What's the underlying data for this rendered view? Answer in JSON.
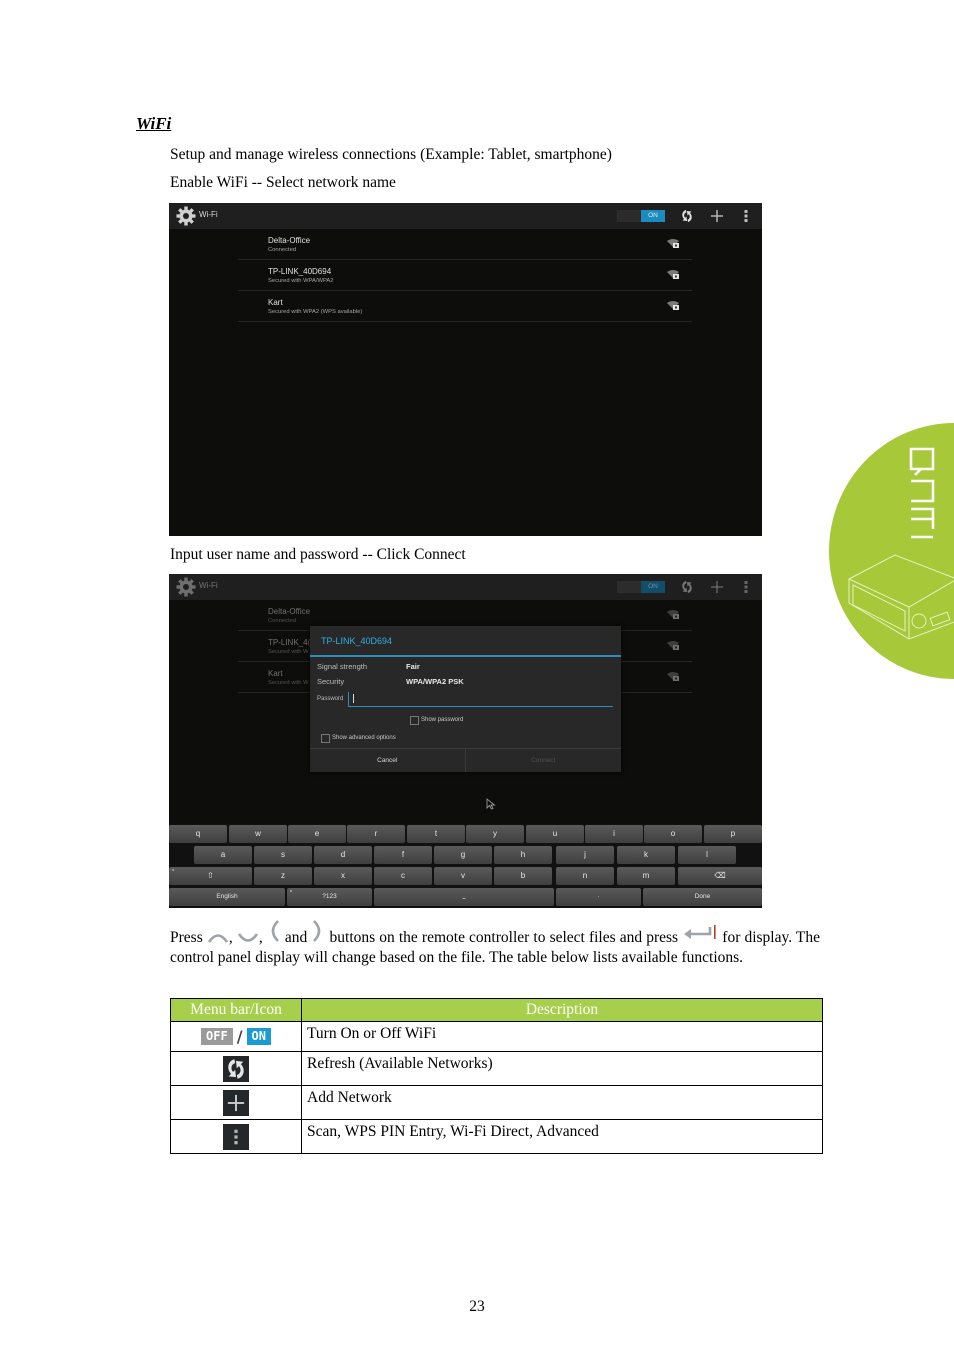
{
  "section_title": "WiFi",
  "intro_line1": "Setup and manage wireless connections (Example: Tablet, smartphone)",
  "intro_line2": "Enable WiFi -- Select network name",
  "caption2": "Input user name and password -- Click Connect",
  "wifi_screen": {
    "title": "Wi-Fi",
    "toggle_state": "ON",
    "icons": [
      "gear-icon",
      "refresh-icon",
      "add-icon",
      "overflow-menu-icon"
    ],
    "networks": [
      {
        "name": "Delta-Office",
        "status": "Connected"
      },
      {
        "name": "TP-LINK_40D694",
        "status": "Secured with WPA/WPA2"
      },
      {
        "name": "Kart",
        "status": "Secured with WPA2 (WPS available)"
      }
    ]
  },
  "connect_dialog": {
    "title": "TP-LINK_40D694",
    "signal_label": "Signal strength",
    "signal_value": "Fair",
    "security_label": "Security",
    "security_value": "WPA/WPA2 PSK",
    "password_label": "Password",
    "password_value": "",
    "show_password_label": "Show password",
    "show_advanced_label": "Show advanced options",
    "cancel_label": "Cancel",
    "connect_label": "Connect",
    "truncated_names": [
      "TP-LINK_4(",
      "Kart"
    ],
    "truncated_status": [
      "Secured with W",
      "Secured with W"
    ]
  },
  "keyboard": {
    "row1": [
      "q",
      "w",
      "e",
      "r",
      "t",
      "y",
      "u",
      "i",
      "o",
      "p"
    ],
    "row2": [
      "a",
      "s",
      "d",
      "f",
      "g",
      "h",
      "j",
      "k",
      "l"
    ],
    "row3": [
      "⇧",
      "z",
      "x",
      "c",
      "v",
      "b",
      "n",
      "m",
      "⌫"
    ],
    "row4": [
      "English",
      "?123",
      "⎵",
      "·",
      "Done"
    ]
  },
  "press_text": {
    "w1": "Press",
    "c1": ",",
    "c2": ",",
    "and": "and",
    "mid": "buttons on the remote controller to select files and press",
    "end": "for display. The control panel display will change based on the file. The table below lists available functions."
  },
  "table": {
    "headers": [
      "Menu bar/Icon",
      "Description"
    ],
    "off_label": "OFF",
    "on_label": "ON",
    "slash": "/",
    "rows": [
      {
        "icon": "off-on-toggle",
        "description": "Turn On or Off WiFi"
      },
      {
        "icon": "refresh-icon",
        "description": "Refresh (Available Networks)"
      },
      {
        "icon": "add-icon",
        "description": "Add Network"
      },
      {
        "icon": "overflow-menu-icon",
        "description": "Scan, WPS PIN Entry, Wi-Fi Direct, Advanced"
      }
    ]
  },
  "brand": "QUMI",
  "colors": {
    "accent_blue": "#1a9bd1",
    "header_green": "#a6cf4b",
    "brand_green": "#a6c839"
  },
  "page_number": "23"
}
